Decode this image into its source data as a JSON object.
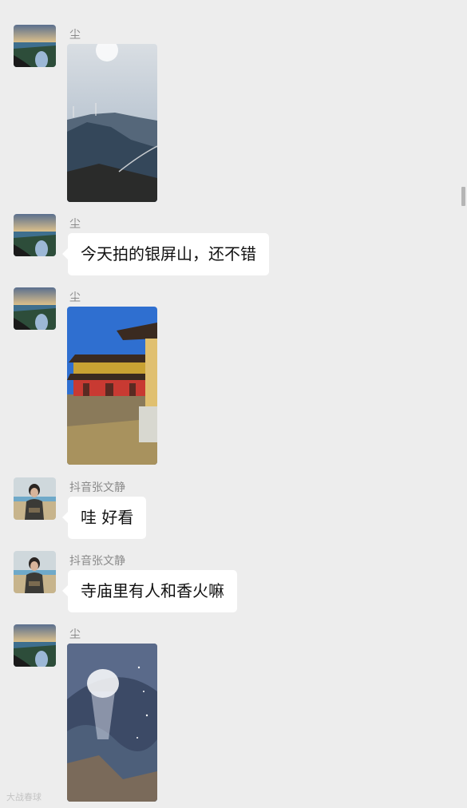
{
  "messages": [
    {
      "sender": "尘",
      "type": "image",
      "image": "mountain-windmill-photo"
    },
    {
      "sender": "尘",
      "type": "text",
      "text": "今天拍的银屏山，还不错"
    },
    {
      "sender": "尘",
      "type": "image",
      "image": "temple-photo"
    },
    {
      "sender": "抖音张文静",
      "type": "text",
      "text": "哇 好看"
    },
    {
      "sender": "抖音张文静",
      "type": "text",
      "text": "寺庙里有人和香火嘛"
    },
    {
      "sender": "尘",
      "type": "image",
      "image": "cave-photo"
    }
  ],
  "watermark": "大战春球",
  "colors": {
    "background": "#ededed",
    "bubble": "#ffffff",
    "sender_text": "#8a8a8a",
    "message_text": "#111111"
  }
}
